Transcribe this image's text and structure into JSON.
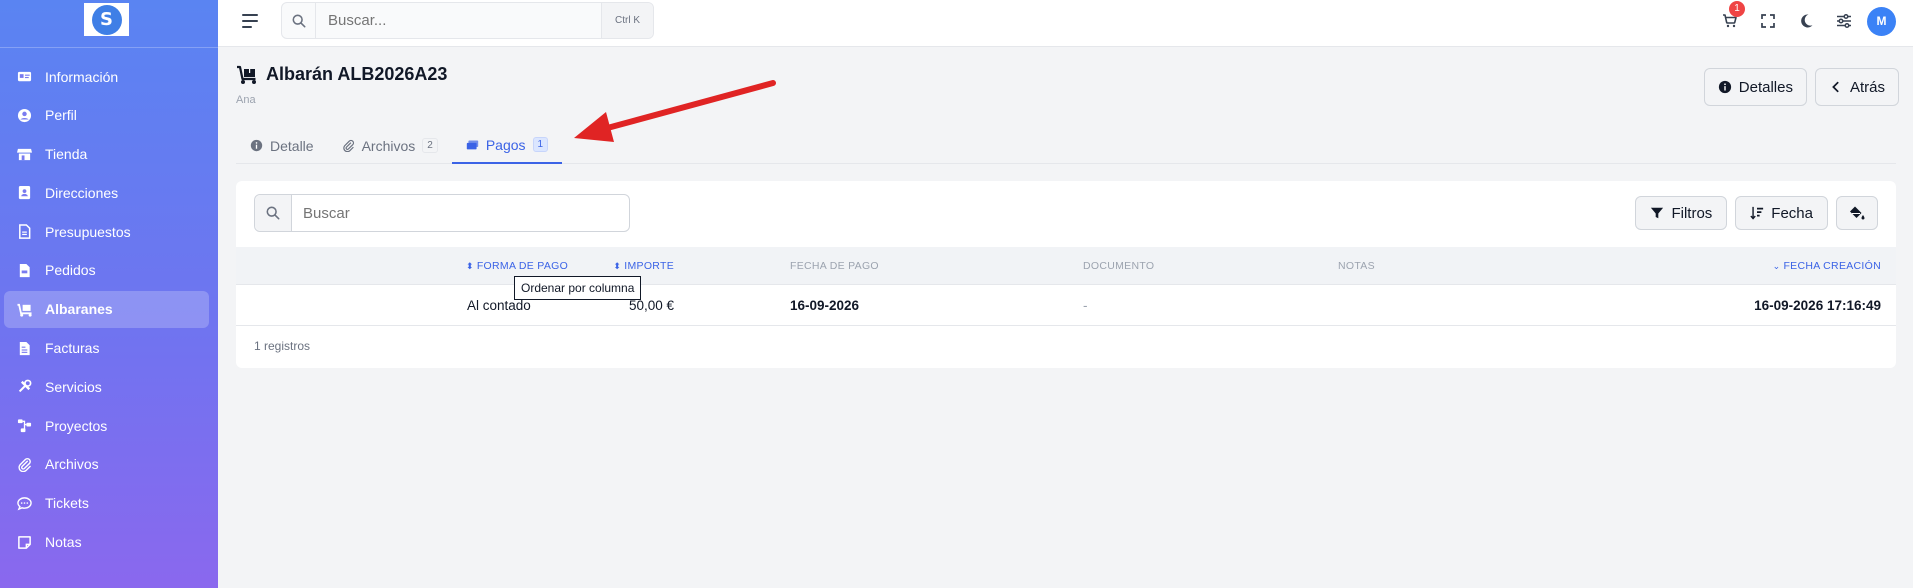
{
  "sidebar": {
    "logo_letter": "S",
    "items": [
      {
        "label": "Información",
        "icon": "id-card-icon"
      },
      {
        "label": "Perfil",
        "icon": "user-circle-icon"
      },
      {
        "label": "Tienda",
        "icon": "store-icon"
      },
      {
        "label": "Direcciones",
        "icon": "address-book-icon"
      },
      {
        "label": "Presupuestos",
        "icon": "file-icon"
      },
      {
        "label": "Pedidos",
        "icon": "file-invoice-icon"
      },
      {
        "label": "Albaranes",
        "icon": "dolly-icon",
        "active": true
      },
      {
        "label": "Facturas",
        "icon": "receipt-icon"
      },
      {
        "label": "Servicios",
        "icon": "tools-icon"
      },
      {
        "label": "Proyectos",
        "icon": "diagram-icon"
      },
      {
        "label": "Archivos",
        "icon": "paperclip-icon"
      },
      {
        "label": "Tickets",
        "icon": "chat-icon"
      },
      {
        "label": "Notas",
        "icon": "note-icon"
      }
    ]
  },
  "topbar": {
    "search_placeholder": "Buscar...",
    "shortcut": "Ctrl K",
    "cart_badge": "1",
    "avatar_initial": "M"
  },
  "header": {
    "title": "Albarán ALB2026A23",
    "subtitle": "Ana",
    "details_button": "Detalles",
    "back_button": "Atrás"
  },
  "tabs": [
    {
      "label": "Detalle",
      "count": ""
    },
    {
      "label": "Archivos",
      "count": "2"
    },
    {
      "label": "Pagos",
      "count": "1",
      "active": true
    }
  ],
  "list": {
    "search_placeholder": "Buscar",
    "filters_button": "Filtros",
    "sort_button": "Fecha",
    "columns": {
      "amount": "IMPORTE",
      "payment_method": "FORMA DE PAGO",
      "payment_date": "FECHA DE PAGO",
      "document": "DOCUMENTO",
      "notes": "NOTAS",
      "created": "FECHA CREACIÓN"
    },
    "rows": [
      {
        "amount": "50,00 €",
        "payment_method": "Al contado",
        "payment_date": "16-09-2026",
        "document": "-",
        "notes": "",
        "created": "16-09-2026 17:16:49"
      }
    ],
    "record_count": "1 registros",
    "tooltip": "Ordenar por columna"
  },
  "colors": {
    "accent": "#3b63e6",
    "sidebar_top": "#5a84f2",
    "sidebar_bottom": "#8a68ee",
    "arrow": "#e02424"
  }
}
